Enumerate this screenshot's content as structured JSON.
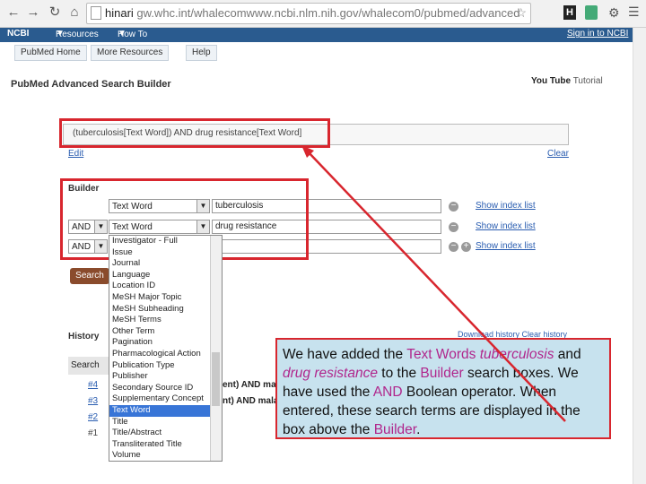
{
  "browser": {
    "url_prefix": "hinari",
    "url_main": "gw.whc.int/whalecomwww.ncbi.nlm.nih.gov/whalecom0/pubmed/advanced",
    "icons": [
      "back-icon",
      "forward-icon",
      "reload-icon",
      "home-icon",
      "page-icon",
      "star-icon",
      "bookmark-h-icon",
      "extension-icon",
      "menu-icon"
    ]
  },
  "ncbi": {
    "logo": "NCBI",
    "resources": "Resources",
    "howto": "How To",
    "signin": "Sign in to NCBI"
  },
  "subnav": [
    "PubMed Home",
    "More Resources",
    "Help"
  ],
  "page_title": "PubMed Advanced Search Builder",
  "youtube": {
    "logo": "You Tube",
    "label": "Tutorial"
  },
  "query_box": {
    "value": "(tuberculosis[Text Word]) AND drug resistance[Text Word]"
  },
  "edit_link": "Edit",
  "clear_link": "Clear",
  "builder": {
    "label": "Builder",
    "rows": [
      {
        "op": "",
        "field": "Text Word",
        "term": "tuberculosis",
        "index": "Show index list"
      },
      {
        "op": "AND",
        "field": "Text Word",
        "term": "drug resistance",
        "index": "Show index list"
      },
      {
        "op": "AND",
        "field": "",
        "term": "",
        "index": "Show index list"
      }
    ]
  },
  "search_button": "Search",
  "history": {
    "label": "History",
    "col_search": "Search",
    "download": "Download history  Clear history",
    "rows": [
      "#4",
      "#3",
      "#2",
      "#1"
    ],
    "partial": [
      "ent) AND mala",
      "nt) AND malar"
    ]
  },
  "dropdown": {
    "items": [
      "Investigator - Full",
      "Issue",
      "Journal",
      "Language",
      "Location ID",
      "MeSH Major Topic",
      "MeSH Subheading",
      "MeSH Terms",
      "Other Term",
      "Pagination",
      "Pharmacological Action",
      "Publication Type",
      "Publisher",
      "Secondary Source ID",
      "Supplementary Concept",
      "Text Word",
      "Title",
      "Title/Abstract",
      "Transliterated Title",
      "Volume"
    ],
    "selected": "Text Word"
  },
  "callout": {
    "t1": "We have added the ",
    "t2": "Text Words ",
    "t3": "tuberculosis",
    "t4": " and ",
    "t5": "drug resistance",
    "t6": " to the ",
    "t7": "Builder",
    "t8": " search boxes.  We have used the ",
    "t9": "AND",
    "t10": " Boolean operator.  When entered, these search terms are displayed in the box above the ",
    "t11": "Builder",
    "t12": "."
  },
  "colors": {
    "highlight": "#b0268c",
    "red": "#d8262e",
    "callout_bg": "#c7e2ee",
    "ncbi_blue": "#2a5b8f"
  }
}
